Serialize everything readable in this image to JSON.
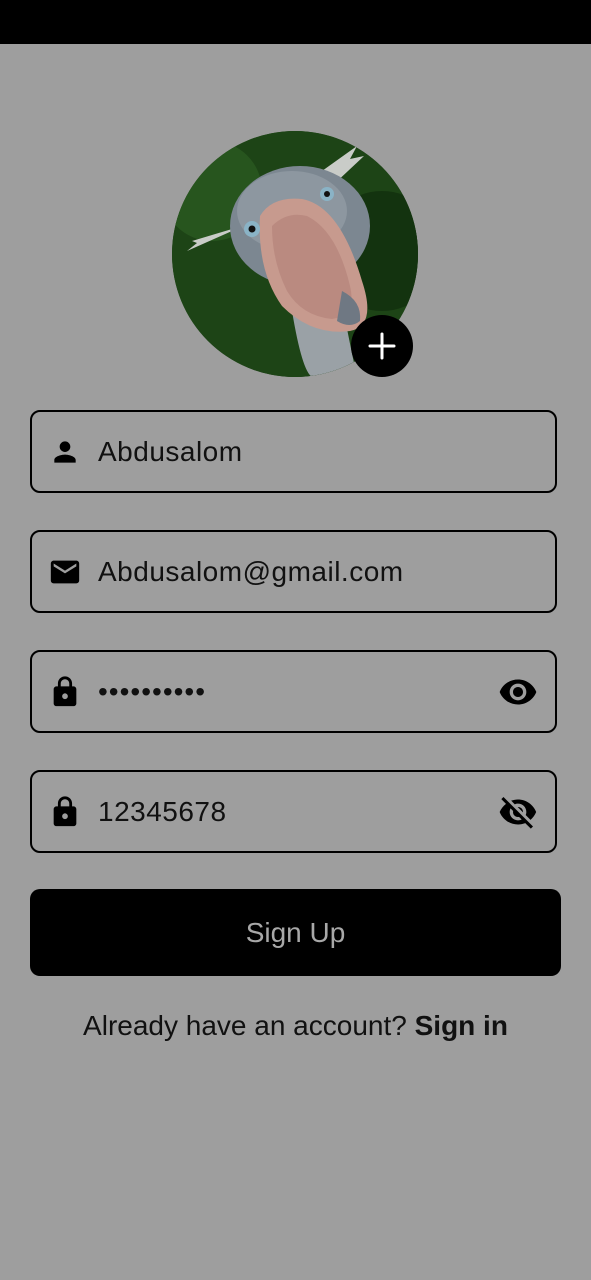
{
  "avatar": {
    "alt": "profile photo",
    "add_icon": "plus-icon"
  },
  "form": {
    "name": {
      "value": "Abdusalom",
      "icon": "person-icon"
    },
    "email": {
      "value": "Abdusalom@gmail.com",
      "icon": "mail-icon"
    },
    "password": {
      "value": "••••••••••",
      "icon": "lock-icon",
      "toggle_icon": "eye-icon"
    },
    "confirm_password": {
      "value": "12345678",
      "icon": "lock-icon",
      "toggle_icon": "eye-off-icon"
    }
  },
  "signup_button": {
    "label": "Sign Up"
  },
  "signin_prompt": {
    "text": "Already have an account?",
    "link": "Sign in"
  },
  "colors": {
    "background": "#9e9e9e",
    "primary": "#000000",
    "button_text": "#a8a8a8"
  }
}
